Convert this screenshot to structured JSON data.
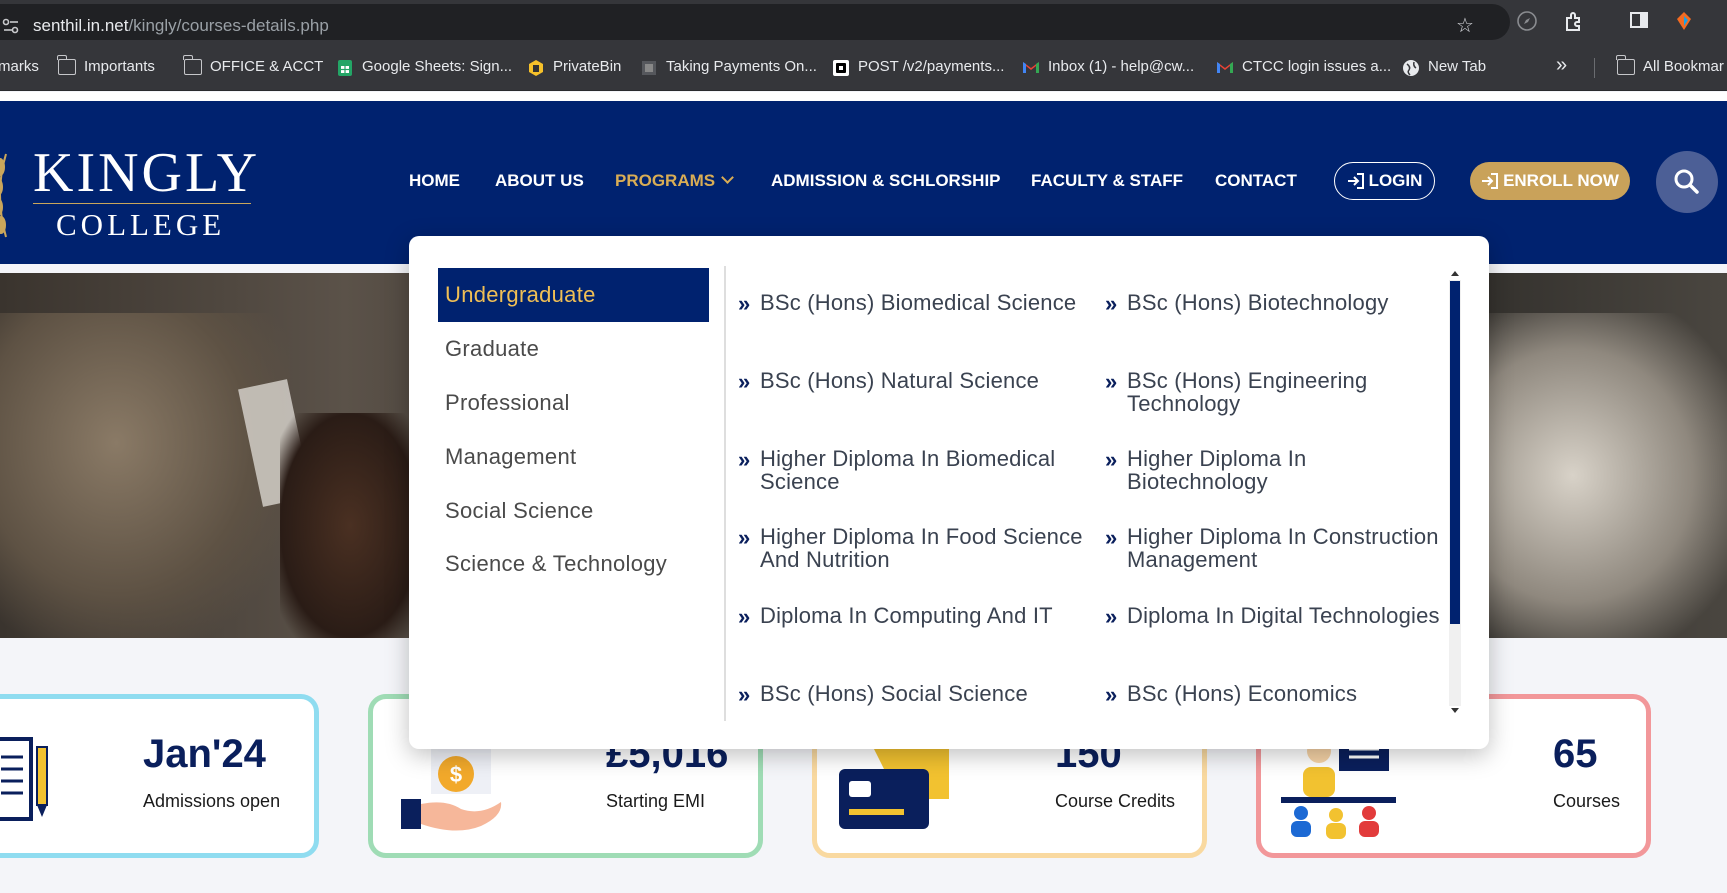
{
  "browser": {
    "url_host": "senthil.in.net",
    "url_path": "/kingly/courses-details.php",
    "bookmarks": [
      {
        "label": "marks",
        "icon": "none"
      },
      {
        "label": "Importants",
        "icon": "folder-icon"
      },
      {
        "label": "OFFICE & ACCT",
        "icon": "folder-icon"
      },
      {
        "label": "Google Sheets: Sign...",
        "icon": "google-sheets-icon"
      },
      {
        "label": "PrivateBin",
        "icon": "privatebin-icon"
      },
      {
        "label": "Taking Payments On...",
        "icon": "page-icon"
      },
      {
        "label": "POST /v2/payments...",
        "icon": "square-icon"
      },
      {
        "label": "Inbox (1) - help@cw...",
        "icon": "gmail-icon"
      },
      {
        "label": "CTCC login issues a...",
        "icon": "gmail-icon"
      },
      {
        "label": "New Tab",
        "icon": "globe-icon"
      }
    ],
    "all_bookmarks_label": "All Bookmar"
  },
  "site": {
    "logo_name": "KINGLY",
    "logo_sub": "COLLEGE",
    "nav": {
      "home": "HOME",
      "about": "ABOUT US",
      "programs": "PROGRAMS",
      "admission": "ADMISSION & SCHLORSHIP",
      "faculty": "FACULTY & STAFF",
      "contact": "CONTACT"
    },
    "login_label": "LOGIN",
    "enroll_label": "ENROLL NOW"
  },
  "mega_menu": {
    "categories": [
      "Undergraduate",
      "Graduate",
      "Professional",
      "Management",
      "Social Science",
      "Science & Technology"
    ],
    "active_category": "Undergraduate",
    "courses": [
      "BSc (Hons) Biomedical Science",
      "BSc (Hons) Biotechnology",
      "BSc (Hons) Natural Science",
      "BSc (Hons) Engineering Technology",
      "Higher Diploma In Biomedical Science",
      "Higher Diploma In Biotechnology",
      "Higher Diploma In Food Science And Nutrition",
      "Higher Diploma In Construction Management",
      "Diploma In Computing And IT",
      "Diploma In Digital Technologies",
      "BSc (Hons) Social Science",
      "BSc (Hons) Economics"
    ]
  },
  "stats": [
    {
      "value": "Jan'24",
      "label": "Admissions open",
      "border": "#8fdcf0"
    },
    {
      "value": "£5,016",
      "label": "Starting EMI",
      "border": "#9fdcb5"
    },
    {
      "value": "150",
      "label": "Course Credits",
      "border": "#f9d9a0"
    },
    {
      "value": "65",
      "label": "Courses",
      "border": "#f2979a"
    }
  ],
  "colors": {
    "brand_navy": "#00226f",
    "brand_gold": "#c9a25a",
    "active_gold": "#f0bf55"
  }
}
